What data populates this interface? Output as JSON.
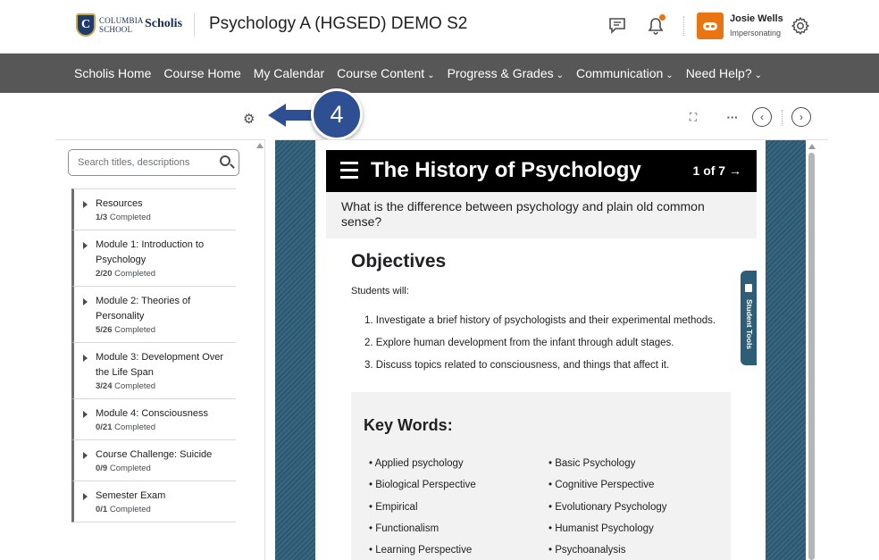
{
  "header": {
    "logo_school_top": "COLUMBIA",
    "logo_school_bottom": "SCHOOL",
    "logo_brand": "Scholis",
    "course_title": "Psychology A (HGSED) DEMO S2",
    "user_name": "Josie Wells",
    "user_role": "Impersonating",
    "icons": [
      "chat-icon",
      "bell-icon",
      "gear-icon"
    ],
    "alert_color": "#e87511"
  },
  "nav": {
    "items": [
      {
        "label": "Scholis Home",
        "dropdown": false
      },
      {
        "label": "Course Home",
        "dropdown": false
      },
      {
        "label": "My Calendar",
        "dropdown": false
      },
      {
        "label": "Course Content",
        "dropdown": true
      },
      {
        "label": "Progress & Grades",
        "dropdown": true
      },
      {
        "label": "Communication",
        "dropdown": true
      },
      {
        "label": "Need Help?",
        "dropdown": true
      }
    ]
  },
  "toc": {
    "search_placeholder": "Search titles, descriptions",
    "modules": [
      {
        "title": "Resources",
        "done": "1/3",
        "suffix": "Completed"
      },
      {
        "title": "Module 1: Introduction to Psychology",
        "done": "2/20",
        "suffix": "Completed"
      },
      {
        "title": "Module 2: Theories of Personality",
        "done": "5/26",
        "suffix": "Completed"
      },
      {
        "title": "Module 3: Development Over the Life Span",
        "done": "3/24",
        "suffix": "Completed"
      },
      {
        "title": "Module 4: Consciousness",
        "done": "0/21",
        "suffix": "Completed"
      },
      {
        "title": "Course Challenge: Suicide",
        "done": "0/9",
        "suffix": "Completed"
      },
      {
        "title": "Semester Exam",
        "done": "0/1",
        "suffix": "Completed"
      }
    ]
  },
  "annotation": {
    "number": "4",
    "color": "#2f4f93"
  },
  "content": {
    "banner_title": "The History of Psychology",
    "page_indicator": "1 of 7 →",
    "question": "What is the difference between psychology and plain old common sense?",
    "objectives_title": "Objectives",
    "objectives_lead": "Students will:",
    "objectives": [
      "1. Investigate a brief history of psychologists and their experimental methods.",
      "2. Explore human development from the infant through adult stages.",
      "3. Discuss topics related to consciousness, and things that affect it."
    ],
    "key_words_title": "Key Words:",
    "key_words_left": [
      "• Applied psychology",
      "• Biological Perspective",
      "• Empirical",
      "• Functionalism",
      "• Learning Perspective"
    ],
    "key_words_right": [
      "• Basic Psychology",
      "• Cognitive Perspective",
      "• Evolutionary Psychology",
      "• Humanist Psychology",
      "• Psychoanalysis"
    ],
    "student_tools_label": "Student Tools",
    "frame_color": "#2e5d78"
  }
}
